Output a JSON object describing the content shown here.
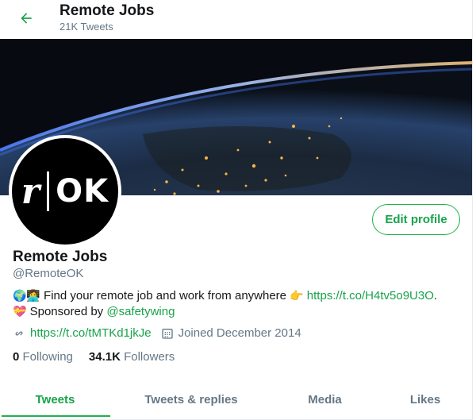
{
  "header": {
    "title": "Remote Jobs",
    "tweet_count": "21K Tweets",
    "back_icon": "arrow-left-icon"
  },
  "profile": {
    "avatar_letters": {
      "left": "r",
      "right": "OK"
    },
    "edit_label": "Edit profile",
    "name": "Remote Jobs",
    "handle": "@RemoteOK",
    "bio": {
      "emoji_prefix": "🌍👩‍💻",
      "text1": " Find your remote job and work from anywhere ",
      "point_emoji": "👉",
      "link1": "https://t.co/H4tv5o9U3O",
      "text1_end": ".",
      "heart_emoji": "💝",
      "text2": " Sponsored by ",
      "mention": "@safetywing"
    },
    "website": "https://t.co/tMTKd1jkJe",
    "joined": "Joined December 2014",
    "following_count": "0",
    "following_label": "Following",
    "followers_count": "34.1K",
    "followers_label": "Followers"
  },
  "tabs": [
    {
      "label": "Tweets",
      "active": true
    },
    {
      "label": "Tweets & replies",
      "active": false
    },
    {
      "label": "Media",
      "active": false
    },
    {
      "label": "Likes",
      "active": false
    }
  ],
  "colors": {
    "accent": "#17a34a",
    "muted": "#657786",
    "text": "#14171a"
  }
}
